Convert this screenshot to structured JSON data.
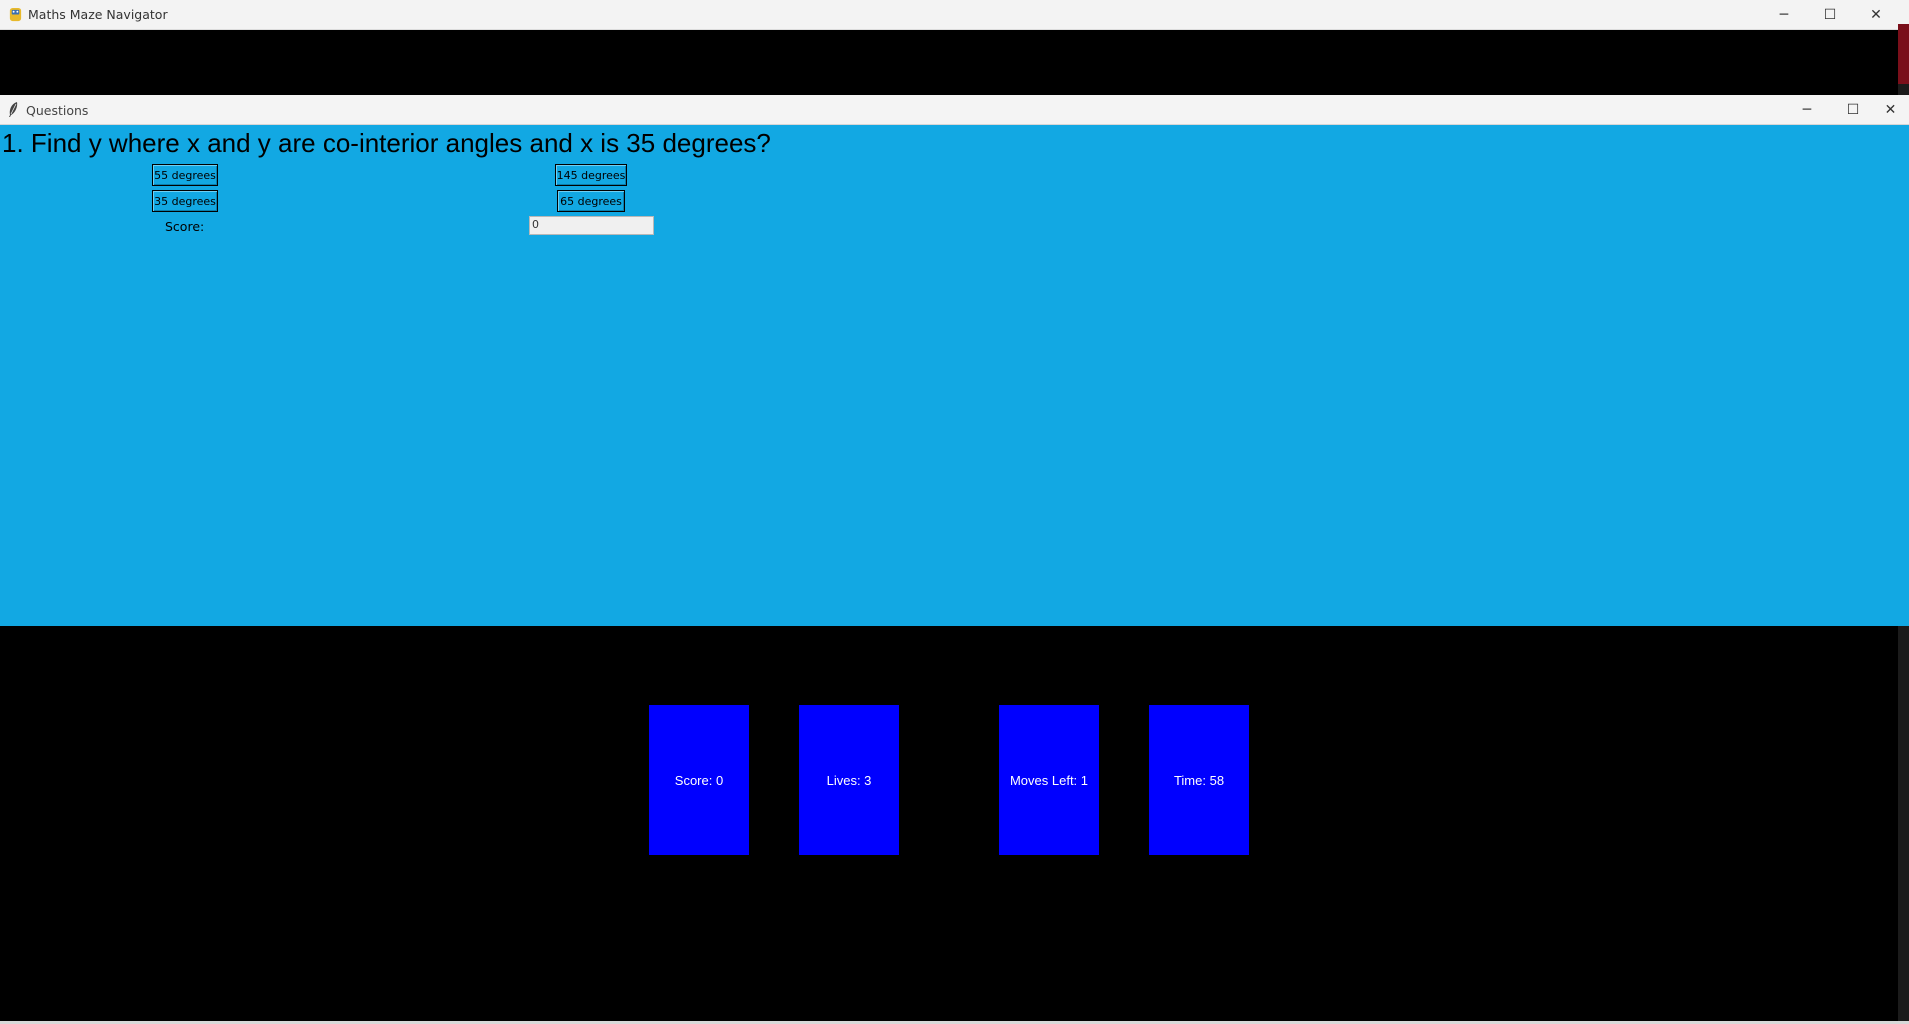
{
  "main_window": {
    "title": "Maths Maze Navigator",
    "controls": {
      "minimize": "─",
      "maximize": "☐",
      "close": "✕"
    }
  },
  "questions_window": {
    "title": "Questions",
    "controls": {
      "minimize": "─",
      "maximize": "☐",
      "close": "✕"
    },
    "question": "1. Find y where x and y are co-interior angles and x is 35 degrees?",
    "answers": [
      "55 degrees",
      "145 degrees",
      "35 degrees",
      "65 degrees"
    ],
    "score_label": "Score:",
    "score_value": "0"
  },
  "stats": {
    "score": "Score: 0",
    "lives": "Lives: 3",
    "moves": "Moves Left: 1",
    "time": "Time: 58"
  },
  "colors": {
    "question_bg": "#12a8e3",
    "stat_box": "#0000ff",
    "game_bg": "#000000"
  }
}
